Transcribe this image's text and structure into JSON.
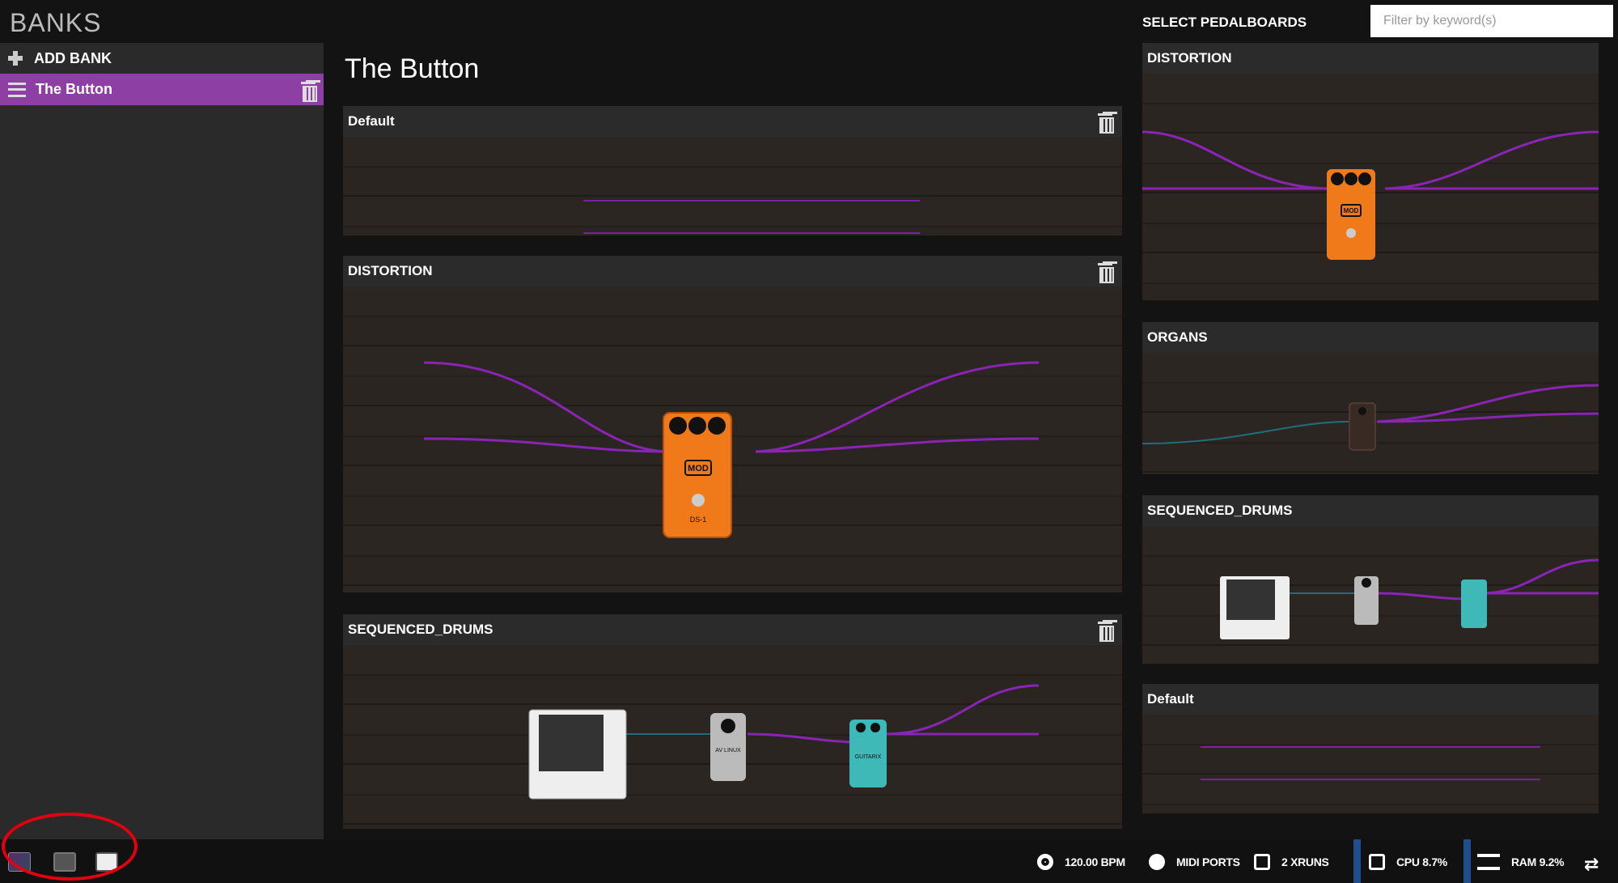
{
  "banks": {
    "title": "BANKS",
    "add_label": "ADD BANK",
    "items": [
      {
        "label": "The Button"
      }
    ]
  },
  "bank_detail": {
    "title": "The Button",
    "pedalboards": [
      {
        "name": "Default"
      },
      {
        "name": "DISTORTION"
      },
      {
        "name": "SEQUENCED_DRUMS"
      }
    ]
  },
  "select": {
    "title": "SELECT PEDALBOARDS",
    "filter_placeholder": "Filter by keyword(s)",
    "pedalboards": [
      {
        "name": "DISTORTION"
      },
      {
        "name": "ORGANS"
      },
      {
        "name": "SEQUENCED_DRUMS"
      },
      {
        "name": "Default"
      }
    ]
  },
  "pedal_labels": {
    "mod_badge": "MOD",
    "ds1": "DS-1",
    "avlinux": "AV LINUX",
    "guitarix": "GUITARIX"
  },
  "footer": {
    "bpm": "120.00 BPM",
    "midi": "MIDI PORTS",
    "xruns": "2 XRUNS",
    "cpu": "CPU 8.7%",
    "ram": "RAM 9.2%"
  },
  "colors": {
    "accent": "#8e3fa4",
    "cable": "#7a1fa0",
    "highlight_circle": "#e20010",
    "status_bar": "#1f4e8c",
    "pedal_orange": "#f07a1a",
    "pedal_teal": "#3fb8b8"
  }
}
